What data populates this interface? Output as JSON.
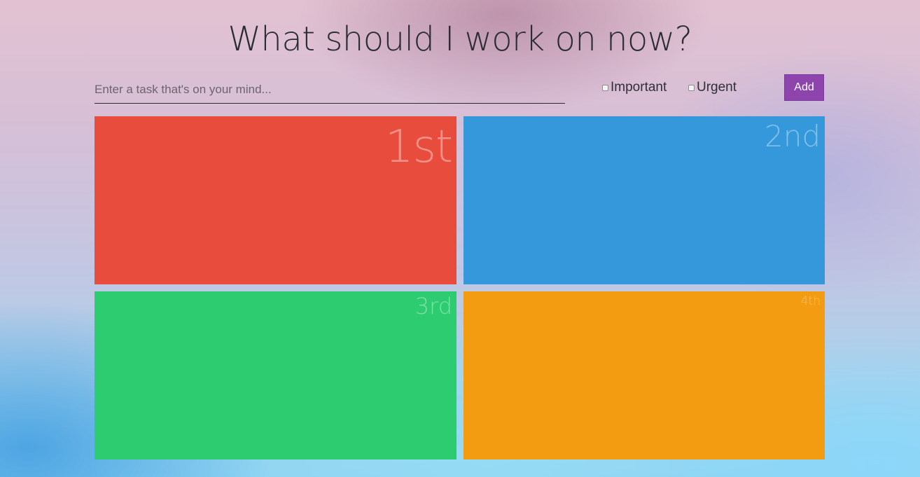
{
  "header": {
    "title": "What should I work on now?"
  },
  "form": {
    "task_placeholder": "Enter a task that's on your mind...",
    "task_value": "",
    "important": {
      "label": "Important",
      "checked": false
    },
    "urgent": {
      "label": "Urgent",
      "checked": false
    },
    "add_label": "Add"
  },
  "quadrants": [
    {
      "label": "1st",
      "color": "#e74c3c"
    },
    {
      "label": "2nd",
      "color": "#3498db"
    },
    {
      "label": "3rd",
      "color": "#2ecc71"
    },
    {
      "label": "4th",
      "color": "#f39c12"
    }
  ],
  "colors": {
    "accent": "#8e44ad"
  }
}
